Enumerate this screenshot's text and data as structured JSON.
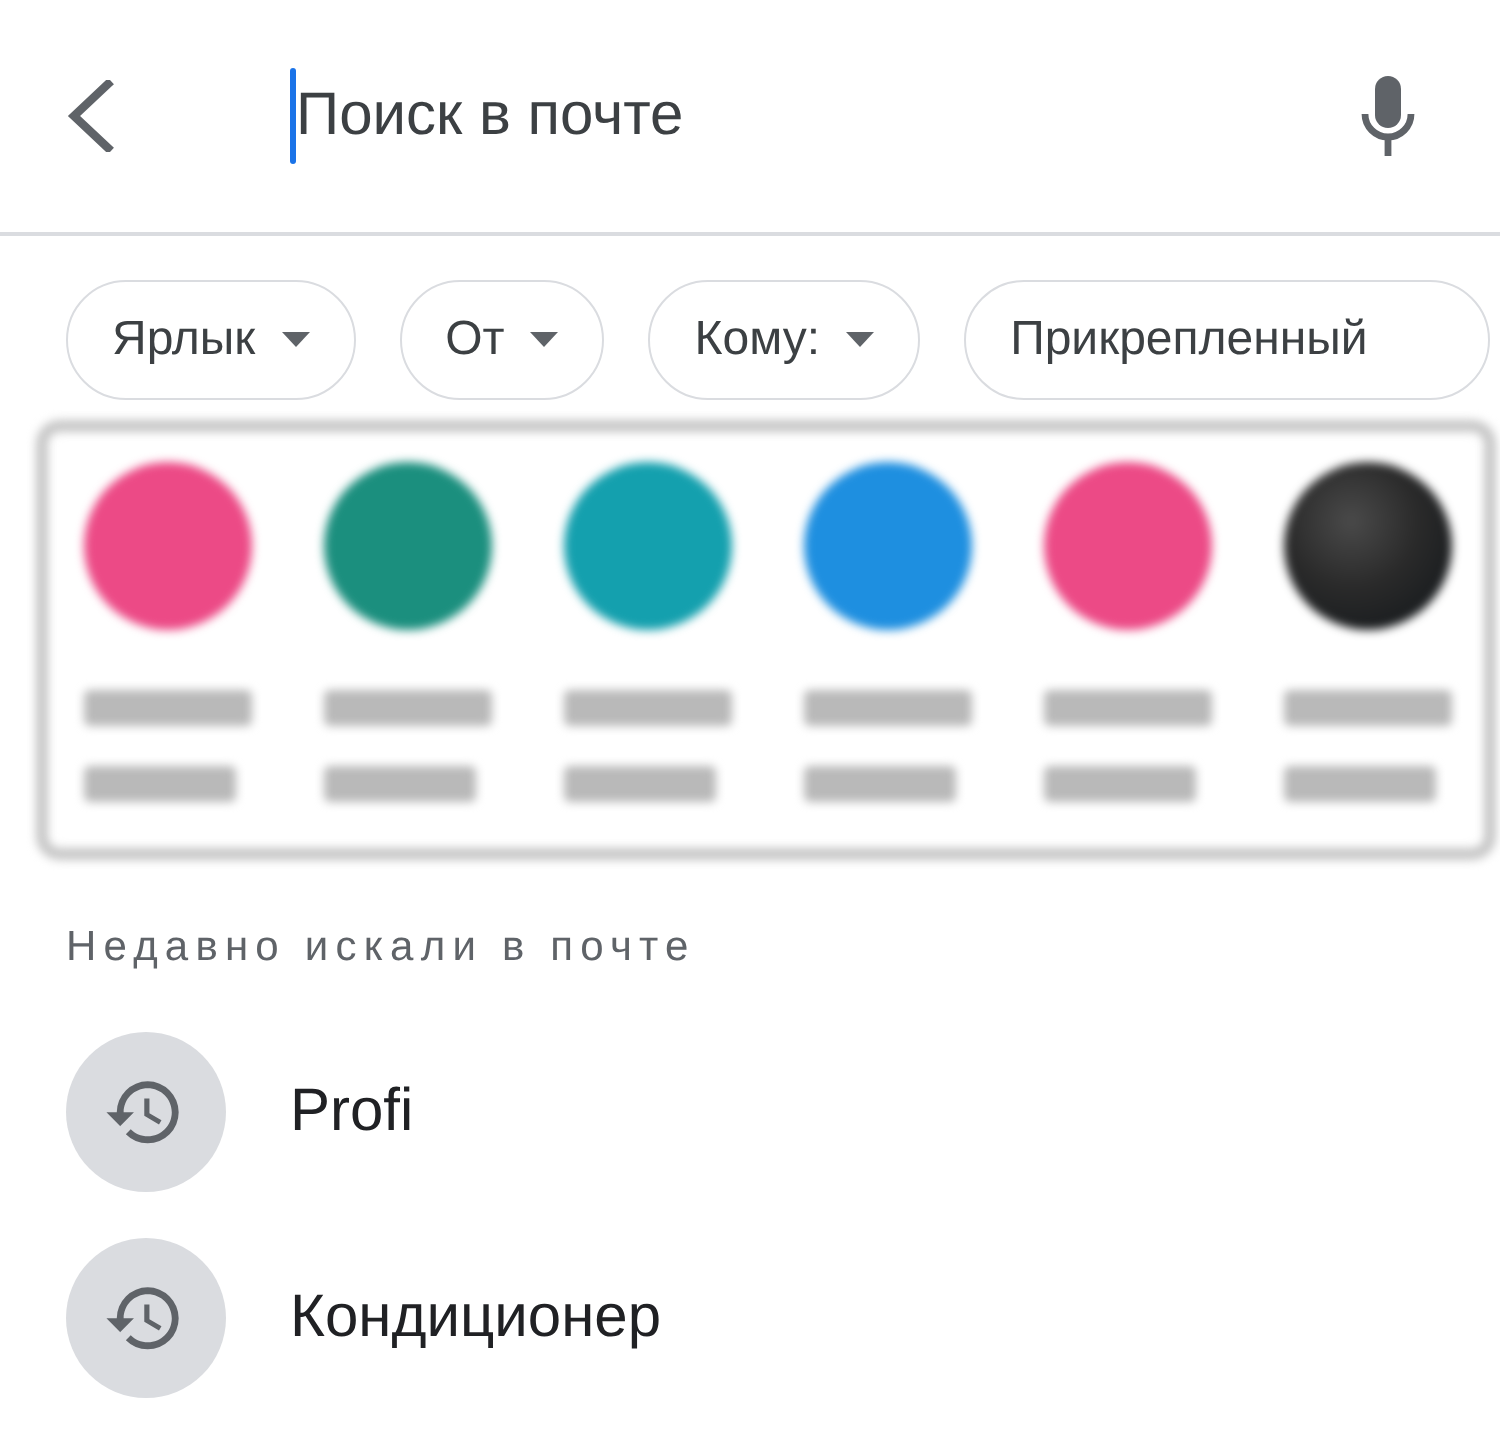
{
  "search": {
    "placeholder": "Поиск в почте",
    "focused": true
  },
  "filters": [
    {
      "label": "Ярлык",
      "dropdown": true
    },
    {
      "label": "От",
      "dropdown": true
    },
    {
      "label": "Кому:",
      "dropdown": true
    },
    {
      "label": "Прикрепленный",
      "dropdown": false
    }
  ],
  "contacts": [
    {
      "kind": "initial",
      "color": "#ec4a86"
    },
    {
      "kind": "initial",
      "color": "#1b8f7e"
    },
    {
      "kind": "initial",
      "color": "#14a0ae"
    },
    {
      "kind": "initial",
      "color": "#1e8fe0"
    },
    {
      "kind": "initial",
      "color": "#ec4a86"
    },
    {
      "kind": "photo"
    }
  ],
  "recent": {
    "heading": "Недавно искали в почте",
    "items": [
      {
        "query": "Profi"
      },
      {
        "query": "Кондиционер"
      }
    ]
  }
}
